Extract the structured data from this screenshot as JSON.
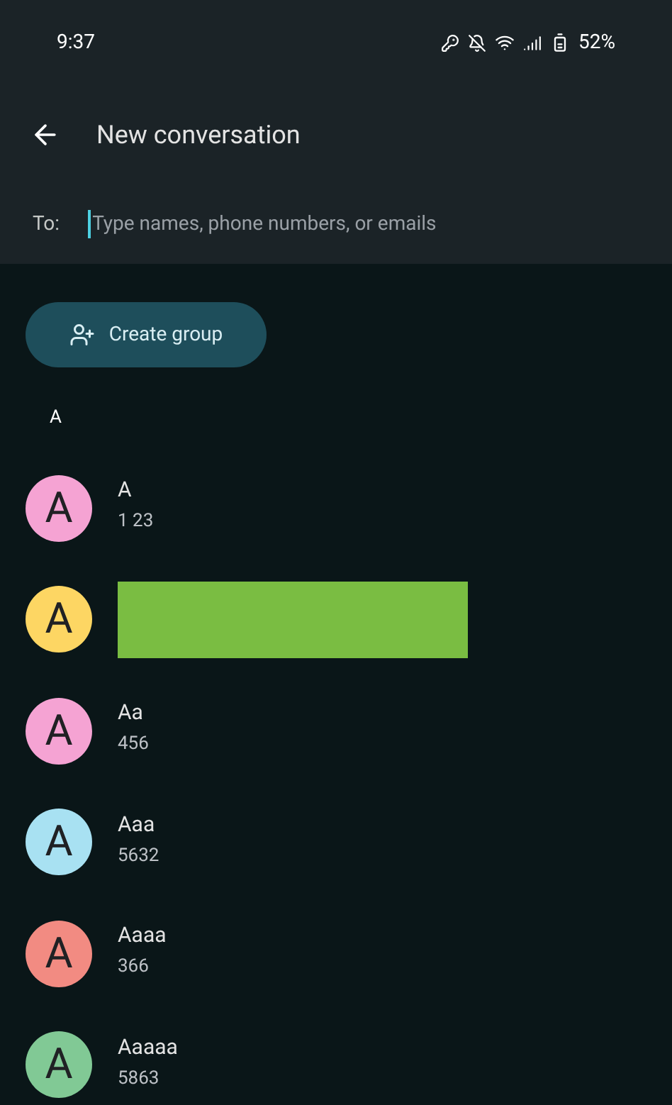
{
  "status_bar": {
    "time": "9:37",
    "battery": "52%"
  },
  "header": {
    "title": "New conversation"
  },
  "recipient": {
    "label": "To:",
    "placeholder": "Type names, phone numbers, or emails"
  },
  "create_group_button": {
    "label": "Create group"
  },
  "section": {
    "letter": "A"
  },
  "contacts": [
    {
      "kind": "contact",
      "initial": "A",
      "color": "#f5a3d3",
      "name": "A",
      "number": "1 23"
    },
    {
      "kind": "redacted",
      "initial": "A",
      "color": "#fdd663"
    },
    {
      "kind": "contact",
      "initial": "A",
      "color": "#f5a3d3",
      "name": "Aa",
      "number": "456"
    },
    {
      "kind": "contact",
      "initial": "A",
      "color": "#a8e1f2",
      "name": "Aaa",
      "number": "5632"
    },
    {
      "kind": "contact",
      "initial": "A",
      "color": "#f28b82",
      "name": "Aaaa",
      "number": "366"
    },
    {
      "kind": "contact",
      "initial": "A",
      "color": "#81c995",
      "name": "Aaaaa",
      "number": "5863"
    }
  ]
}
